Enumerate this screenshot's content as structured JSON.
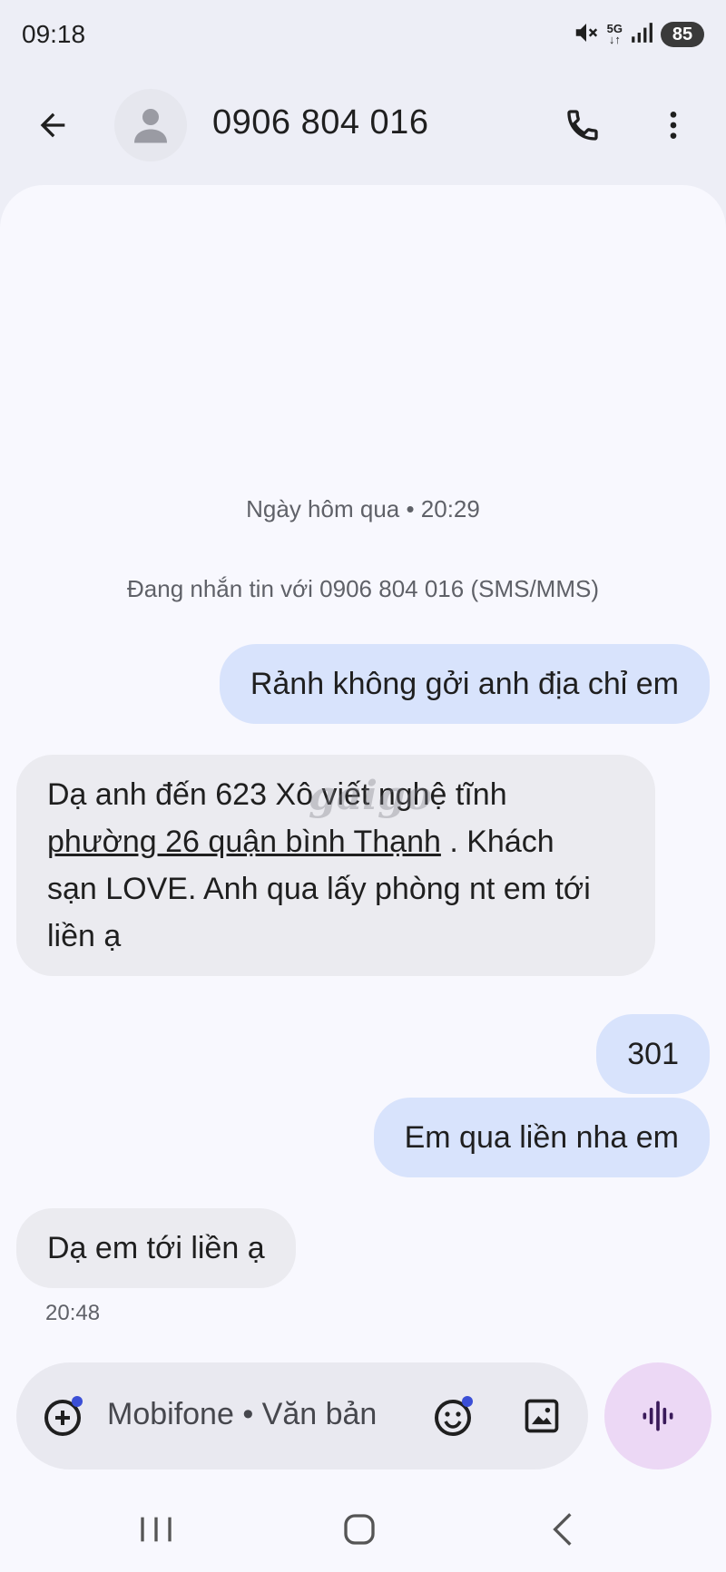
{
  "status_bar": {
    "time": "09:18",
    "network_label": "5G",
    "battery": "85",
    "icons": [
      "mute-icon",
      "5g-icon",
      "signal-icon",
      "battery-icon"
    ]
  },
  "header": {
    "contact_name": "0906 804 016",
    "icons": [
      "back-arrow-icon",
      "person-icon",
      "phone-icon",
      "more-vert-icon"
    ]
  },
  "conversation": {
    "date_header": "Ngày hôm qua • 20:29",
    "sms_info": "Đang nhắn tin với 0906 804 016 (SMS/MMS)",
    "watermark": "gaigo",
    "messages": [
      {
        "direction": "outgoing",
        "text": "Rảnh không gởi anh địa chỉ em"
      },
      {
        "direction": "incoming",
        "line1": "Dạ anh đến 623 Xô viết nghệ tĩnh",
        "link": "phường 26 quận bình Thạnh",
        "line2_tail": " . Khách",
        "line3": "sạn LOVE. Anh qua lấy phòng nt em tới",
        "line4": "liền ạ"
      },
      {
        "direction": "outgoing",
        "text": "301"
      },
      {
        "direction": "outgoing",
        "text": "Em qua liền nha em"
      },
      {
        "direction": "incoming",
        "text": "Dạ em tới liền ạ"
      }
    ],
    "last_time": "20:48"
  },
  "compose": {
    "placeholder": "Mobifone • Văn bản",
    "icons": [
      "add-circle-icon",
      "emoji-icon",
      "gallery-icon",
      "voice-waveform-icon"
    ]
  },
  "colors": {
    "background": "#edeef6",
    "surface": "#f8f8fe",
    "outgoing_bubble": "#d8e3fc",
    "incoming_bubble": "#ebebf0",
    "voice_button": "#ecd8f5",
    "accent_dot": "#3b4fd6"
  }
}
